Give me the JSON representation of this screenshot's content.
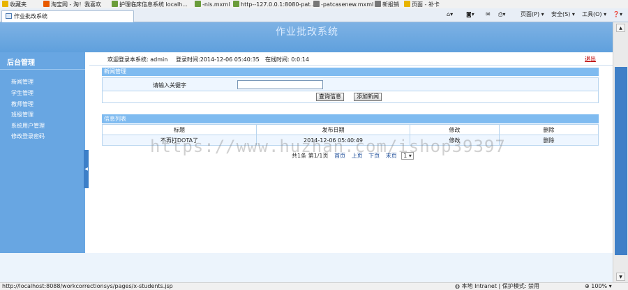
{
  "favorites": {
    "items": [
      {
        "label": "收藏夹",
        "icon": "star-icon",
        "color": "#e8b400"
      },
      {
        "label": "淘宝网 - 淘！我喜欢",
        "icon": "taobao-icon",
        "color": "#e85a00"
      },
      {
        "label": "护理临床信息系统 localh...",
        "icon": "page-icon",
        "color": "#6a9c3a"
      },
      {
        "label": "-nis.mxml",
        "icon": "page-icon",
        "color": "#6a9c3a"
      },
      {
        "label": "http--127.0.0.1:8080-pat...",
        "icon": "page-icon",
        "color": "#6a9c3a"
      },
      {
        "label": "-patcasenew.mxml",
        "icon": "page-icon",
        "color": "#777777"
      },
      {
        "label": "新报销",
        "icon": "page-icon",
        "color": "#777777"
      },
      {
        "label": "页面 - 补卡",
        "icon": "page-icon",
        "color": "#e8b400"
      }
    ]
  },
  "browser": {
    "tab_title": "作业批改系统",
    "toolbar": [
      {
        "label": "页面(P)",
        "icon": "page-menu-icon"
      },
      {
        "label": "安全(S)",
        "icon": "safety-menu-icon"
      },
      {
        "label": "工具(O)",
        "icon": "tools-menu-icon"
      }
    ]
  },
  "banner": {
    "title": "作业批改系统"
  },
  "sidebar": {
    "title": "后台管理",
    "items": [
      {
        "label": "新闻管理"
      },
      {
        "label": "学生管理"
      },
      {
        "label": "教师管理"
      },
      {
        "label": "班级管理"
      },
      {
        "label": "系统用户管理"
      },
      {
        "label": "修改登录密码"
      }
    ]
  },
  "topstrip": {
    "welcome": "欢迎登录本系统: admin",
    "login_time": "登录时间:2014-12-06 05:40:35",
    "online_time": "在线时间: 0:0:14",
    "logout": "退出"
  },
  "news": {
    "header": "新闻管理",
    "keyword_label": "请输入关键字",
    "keyword_value": "",
    "search_button": "查询信息",
    "add_button": "添加新闻"
  },
  "info": {
    "header": "信息列表",
    "columns": [
      "标题",
      "发布日期",
      "修改",
      "删除"
    ],
    "rows": [
      {
        "title": "不再打DOTA了",
        "date": "2014-12-06 05:40:49",
        "edit": "修改",
        "delete": "删除"
      }
    ]
  },
  "pager": {
    "summary": "共1条 第1/1页",
    "first": "首页",
    "prev": "上页",
    "next": "下页",
    "last": "末页",
    "page_select": "1"
  },
  "status": {
    "url": "http://localhost:8088/workcorrectionsys/pages/x-students.jsp",
    "zone": "本地 Intranet | 保护模式: 禁用",
    "zoom": "100%"
  },
  "watermark": "https://www.huzhan.com/ishop39397"
}
